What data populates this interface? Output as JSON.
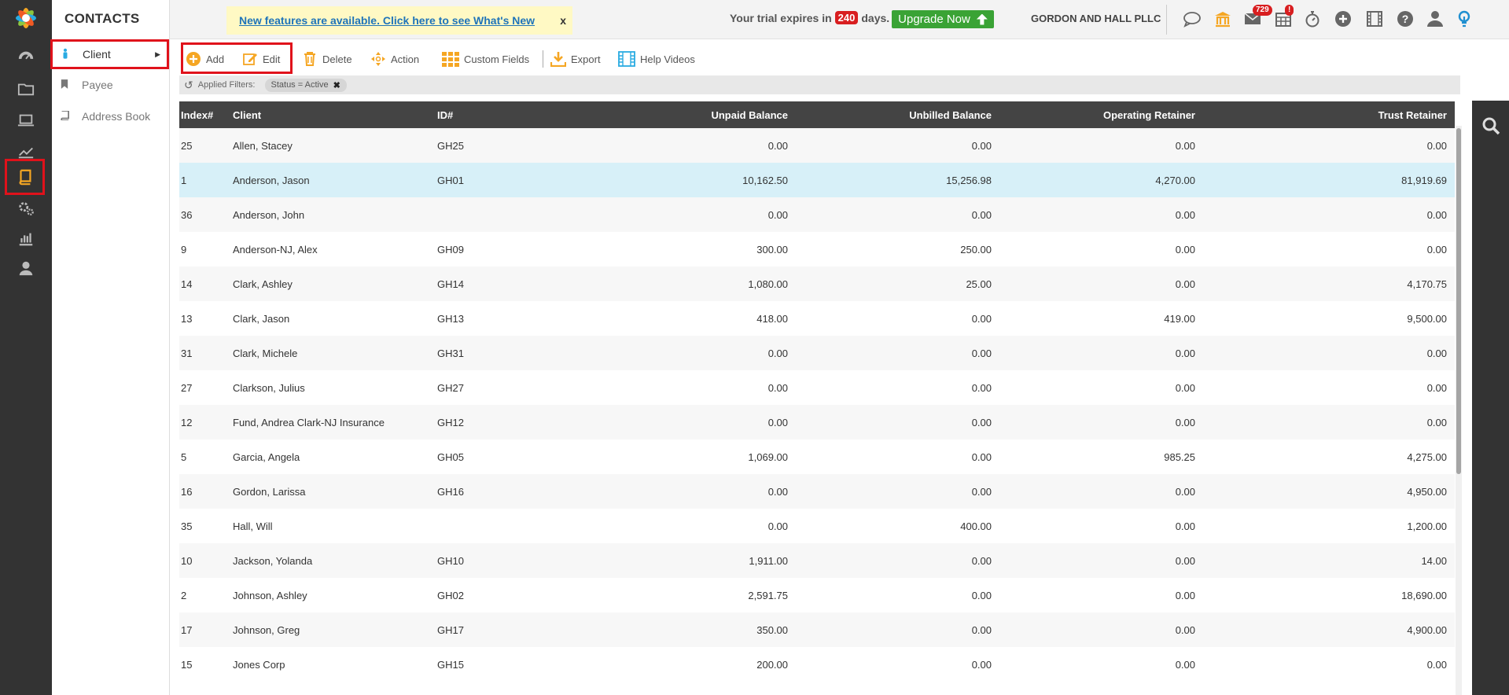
{
  "app": {
    "section_title": "CONTACTS"
  },
  "subnav": {
    "items": [
      {
        "label": "Client",
        "icon": "person-icon",
        "active": true
      },
      {
        "label": "Payee",
        "icon": "bookmark-icon",
        "active": false
      },
      {
        "label": "Address Book",
        "icon": "book-icon",
        "active": false
      }
    ]
  },
  "header": {
    "notice_text": "New features are available. Click here to see What's New",
    "notice_close": "x",
    "trial_prefix": "Your trial expires in",
    "trial_days": "240",
    "trial_suffix": "days.",
    "upgrade_label": "Upgrade Now",
    "firm_name": "GORDON AND HALL PLLC",
    "mail_badge": "729",
    "calendar_badge": "!"
  },
  "toolbar": {
    "add": "Add",
    "edit": "Edit",
    "delete": "Delete",
    "action": "Action",
    "custom_fields": "Custom Fields",
    "export": "Export",
    "help_videos": "Help Videos"
  },
  "filters": {
    "label": "Applied Filters:",
    "chip": "Status = Active",
    "chip_close": "✖"
  },
  "table": {
    "columns": [
      "Index#",
      "Client",
      "ID#",
      "Unpaid Balance",
      "Unbilled Balance",
      "Operating Retainer",
      "Trust Retainer"
    ],
    "rows": [
      [
        "25",
        "Allen, Stacey",
        "GH25",
        "0.00",
        "0.00",
        "0.00",
        "0.00"
      ],
      [
        "1",
        "Anderson, Jason",
        "GH01",
        "10,162.50",
        "15,256.98",
        "4,270.00",
        "81,919.69"
      ],
      [
        "36",
        "Anderson, John",
        "",
        "0.00",
        "0.00",
        "0.00",
        "0.00"
      ],
      [
        "9",
        "Anderson-NJ, Alex",
        "GH09",
        "300.00",
        "250.00",
        "0.00",
        "0.00"
      ],
      [
        "14",
        "Clark, Ashley",
        "GH14",
        "1,080.00",
        "25.00",
        "0.00",
        "4,170.75"
      ],
      [
        "13",
        "Clark, Jason",
        "GH13",
        "418.00",
        "0.00",
        "419.00",
        "9,500.00"
      ],
      [
        "31",
        "Clark, Michele",
        "GH31",
        "0.00",
        "0.00",
        "0.00",
        "0.00"
      ],
      [
        "27",
        "Clarkson, Julius",
        "GH27",
        "0.00",
        "0.00",
        "0.00",
        "0.00"
      ],
      [
        "12",
        "Fund, Andrea Clark-NJ Insurance",
        "GH12",
        "0.00",
        "0.00",
        "0.00",
        "0.00"
      ],
      [
        "5",
        "Garcia, Angela",
        "GH05",
        "1,069.00",
        "0.00",
        "985.25",
        "4,275.00"
      ],
      [
        "16",
        "Gordon, Larissa",
        "GH16",
        "0.00",
        "0.00",
        "0.00",
        "4,950.00"
      ],
      [
        "35",
        "Hall, Will",
        "",
        "0.00",
        "400.00",
        "0.00",
        "1,200.00"
      ],
      [
        "10",
        "Jackson, Yolanda",
        "GH10",
        "1,911.00",
        "0.00",
        "0.00",
        "14.00"
      ],
      [
        "2",
        "Johnson, Ashley",
        "GH02",
        "2,591.75",
        "0.00",
        "0.00",
        "18,690.00"
      ],
      [
        "17",
        "Johnson, Greg",
        "GH17",
        "350.00",
        "0.00",
        "0.00",
        "4,900.00"
      ],
      [
        "15",
        "Jones Corp",
        "GH15",
        "200.00",
        "0.00",
        "0.00",
        "0.00"
      ]
    ],
    "selected_row": 1
  },
  "colors": {
    "rail": "#333333",
    "accent_orange": "#f5a623",
    "highlight_red": "#e0121b",
    "selected_row": "#d7f0f8",
    "upgrade_green": "#3aa335"
  }
}
